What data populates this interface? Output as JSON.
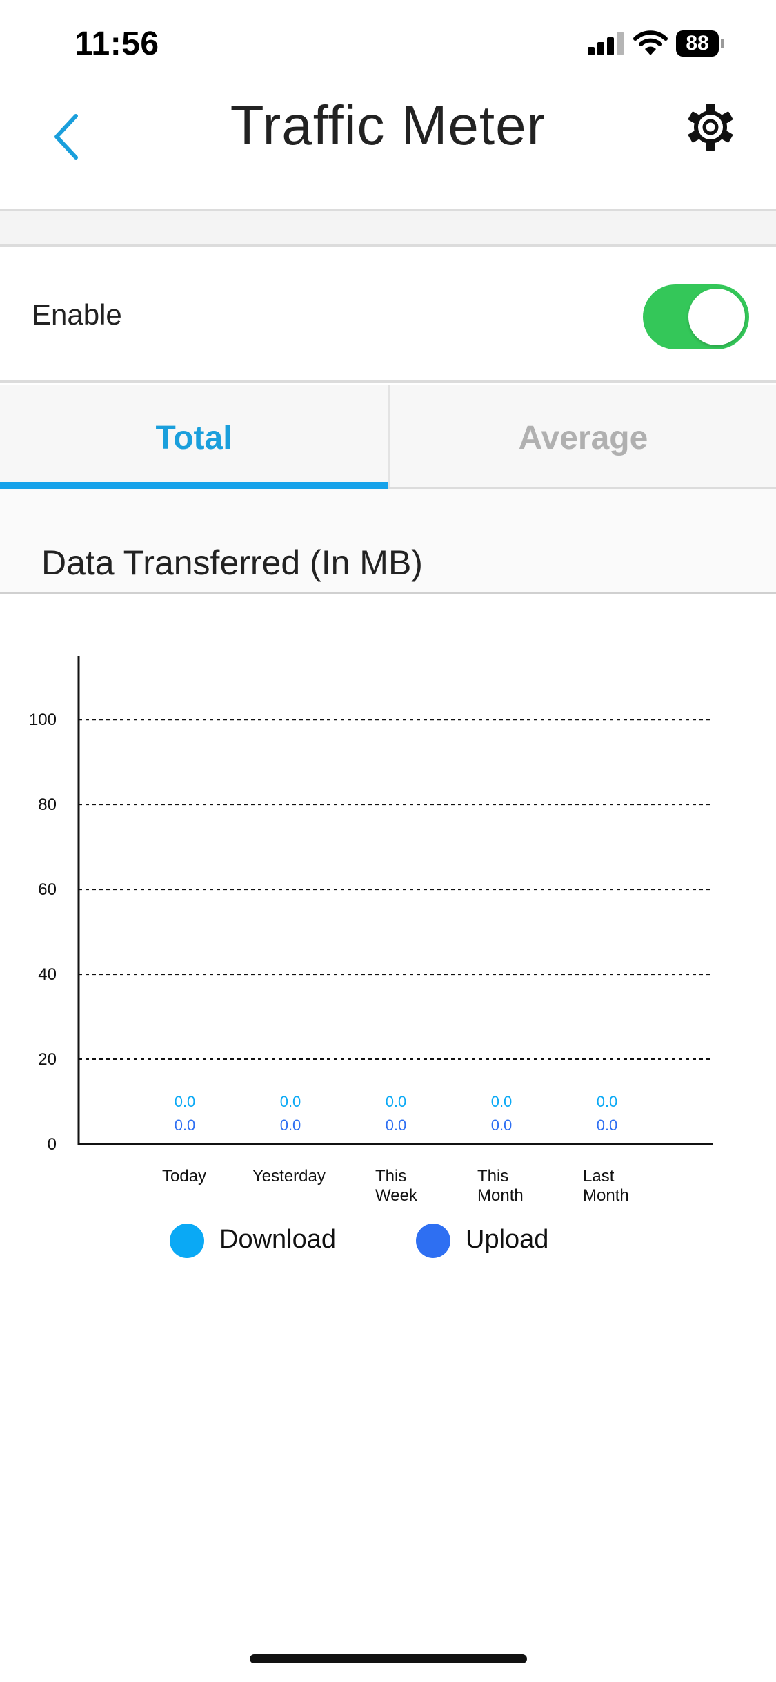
{
  "status_bar": {
    "time": "11:56",
    "battery": "88",
    "icons": [
      "cellular-signal-icon",
      "wifi-icon",
      "battery-icon"
    ]
  },
  "nav": {
    "title": "Traffic Meter",
    "back_icon": "chevron-left-icon",
    "settings_icon": "gear-icon",
    "accent_color": "#1a9fdc"
  },
  "enable": {
    "label": "Enable",
    "on": true,
    "on_color": "#34c759"
  },
  "tabs": [
    {
      "label": "Total",
      "active": true
    },
    {
      "label": "Average",
      "active": false
    }
  ],
  "section": {
    "title": "Data Transferred (In MB)"
  },
  "chart_data": {
    "type": "bar",
    "categories": [
      "Today",
      "Yesterday",
      "This Week",
      "This Month",
      "Last Month"
    ],
    "category_lines": [
      [
        "Today"
      ],
      [
        "Yesterday"
      ],
      [
        "This",
        "Week"
      ],
      [
        "This",
        "Month"
      ],
      [
        "Last",
        "Month"
      ]
    ],
    "series": [
      {
        "name": "Download",
        "color": "#0aa9f5",
        "values": [
          0.0,
          0.0,
          0.0,
          0.0,
          0.0
        ],
        "labels": [
          "0.0",
          "0.0",
          "0.0",
          "0.0",
          "0.0"
        ]
      },
      {
        "name": "Upload",
        "color": "#2e6ff2",
        "values": [
          0.0,
          0.0,
          0.0,
          0.0,
          0.0
        ],
        "labels": [
          "0.0",
          "0.0",
          "0.0",
          "0.0",
          "0.0"
        ]
      }
    ],
    "ylim": [
      0,
      115
    ],
    "yticks": [
      "0",
      "20",
      "40",
      "60",
      "80",
      "100"
    ],
    "ytick_values": [
      0,
      20,
      40,
      60,
      80,
      100
    ],
    "grid": true,
    "legend": "bottom"
  }
}
